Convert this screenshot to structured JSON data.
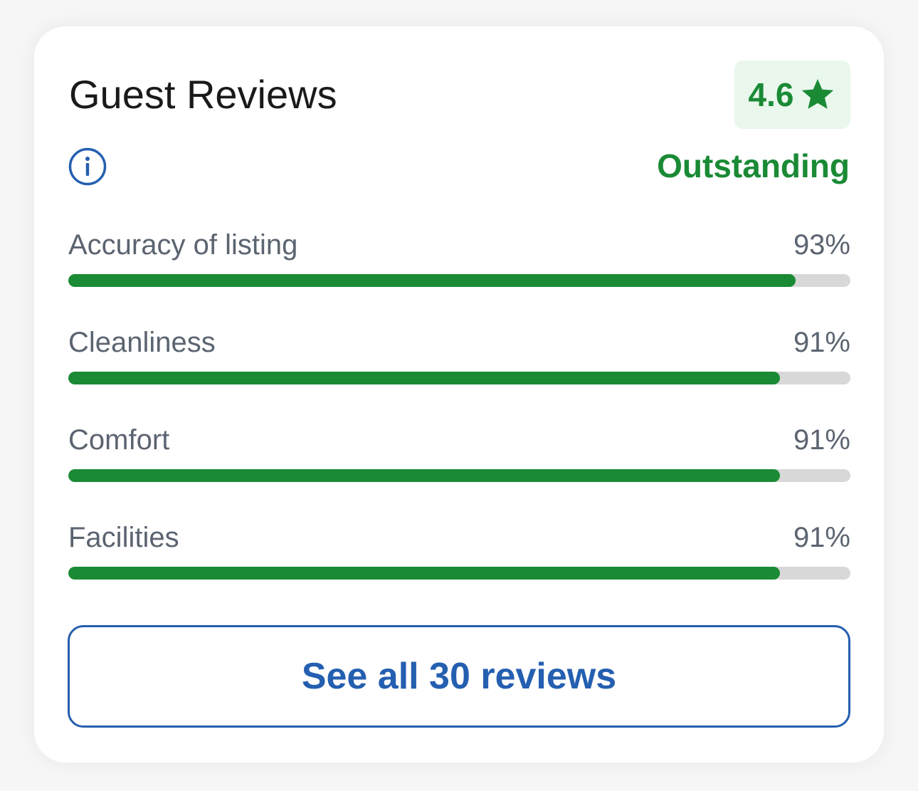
{
  "card": {
    "title": "Guest Reviews",
    "score": "4.6",
    "score_icon": "star-icon",
    "rating_word": "Outstanding",
    "info_icon": "info-icon"
  },
  "categories": [
    {
      "label": "Accuracy of listing",
      "value": "93%",
      "percent": 93
    },
    {
      "label": "Cleanliness",
      "value": "91%",
      "percent": 91
    },
    {
      "label": "Comfort",
      "value": "91%",
      "percent": 91
    },
    {
      "label": "Facilities",
      "value": "91%",
      "percent": 91
    }
  ],
  "see_all_label": "See all 30 reviews",
  "colors": {
    "accent_green": "#1a8a35",
    "badge_bg": "#e9f7ec",
    "link_blue": "#245fb0",
    "track_gray": "#d8d8d8",
    "muted_text": "#5b6470"
  }
}
